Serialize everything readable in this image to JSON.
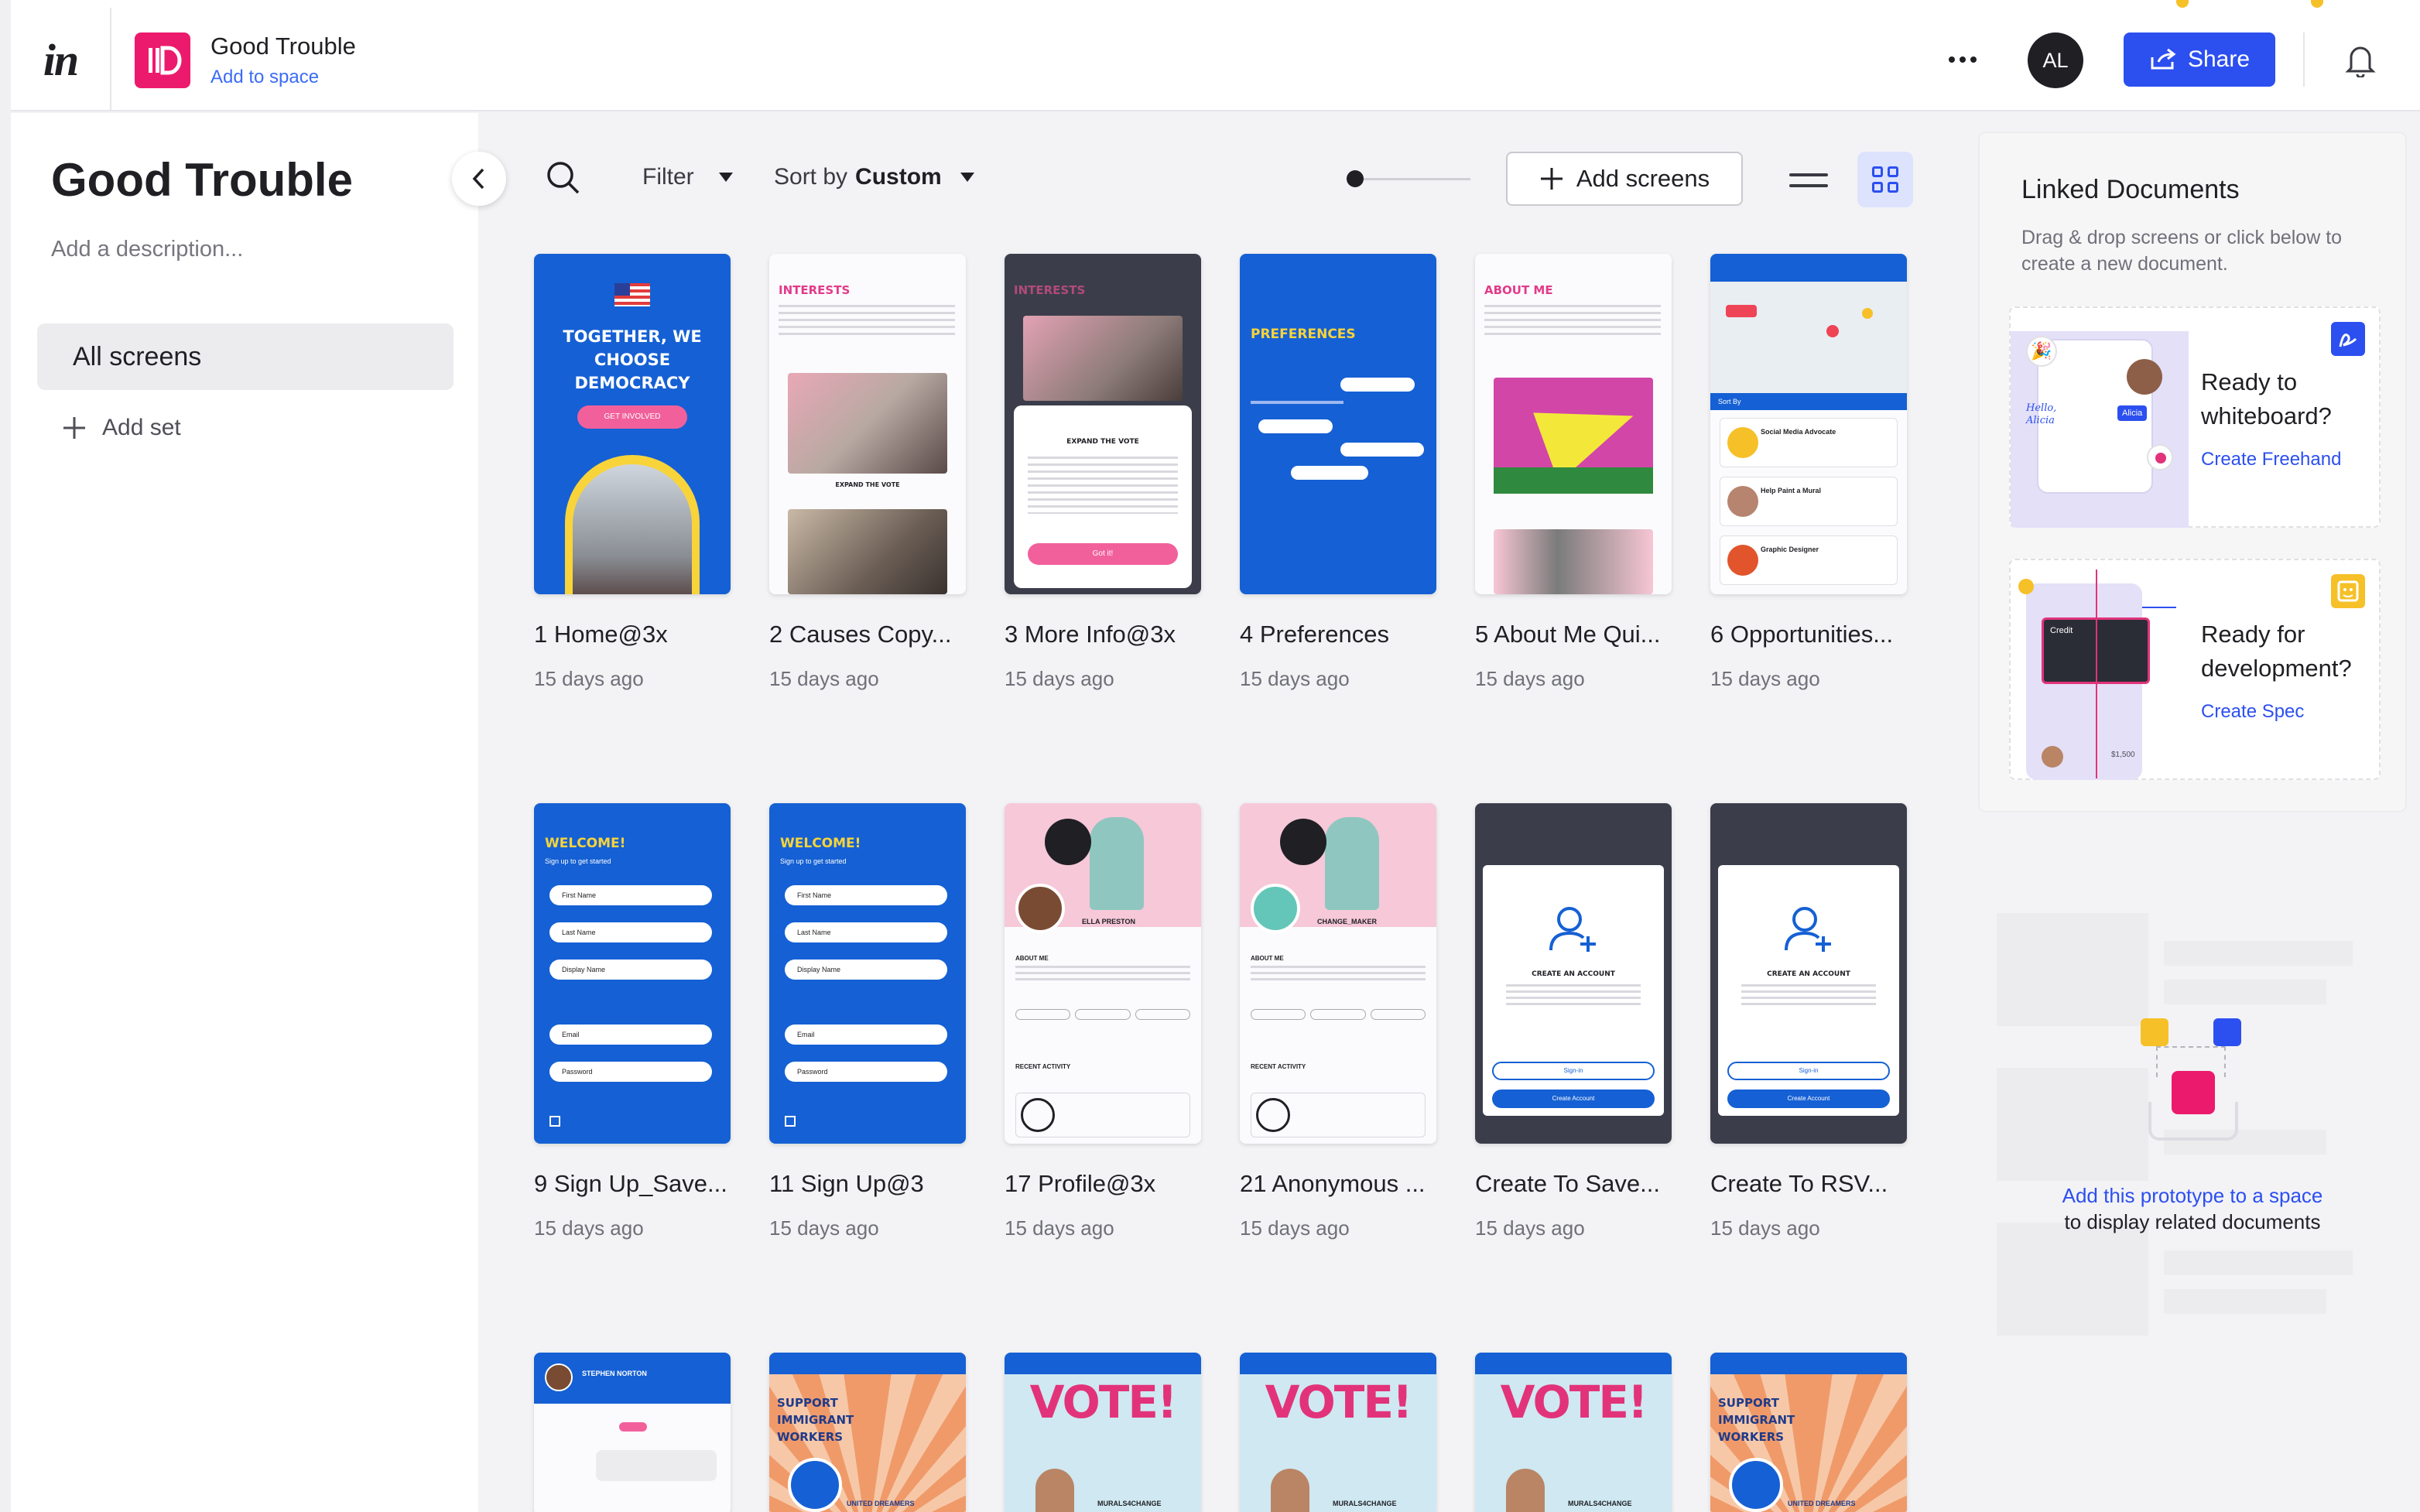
{
  "app": {
    "logo": "in",
    "project_title": "Good Trouble",
    "add_to_space": "Add to space"
  },
  "header": {
    "more_label": "More options",
    "avatar_initials": "AL",
    "share_label": "Share",
    "accent": "#2c4ff0",
    "brand": "#ec1a6c"
  },
  "sidebar": {
    "title": "Good Trouble",
    "description_placeholder": "Add a description...",
    "all_screens": "All screens",
    "add_set": "Add set"
  },
  "toolbar": {
    "filter": "Filter",
    "sort_prefix": "Sort by",
    "sort_value": "Custom",
    "add_screens": "Add screens"
  },
  "screens": [
    {
      "name": "1 Home@3x",
      "date": "15 days ago"
    },
    {
      "name": "2 Causes Copy...",
      "date": "15 days ago"
    },
    {
      "name": "3 More Info@3x",
      "date": "15 days ago"
    },
    {
      "name": "4 Preferences",
      "date": "15 days ago"
    },
    {
      "name": "5 About Me Qui...",
      "date": "15 days ago"
    },
    {
      "name": "6 Opportunities...",
      "date": "15 days ago"
    },
    {
      "name": "9 Sign Up_Save...",
      "date": "15 days ago"
    },
    {
      "name": "11 Sign Up@3",
      "date": "15 days ago"
    },
    {
      "name": "17 Profile@3x",
      "date": "15 days ago"
    },
    {
      "name": "21 Anonymous ...",
      "date": "15 days ago"
    },
    {
      "name": "Create To Save...",
      "date": "15 days ago"
    },
    {
      "name": "Create To RSV...",
      "date": "15 days ago"
    }
  ],
  "thumbs": {
    "home": "TOGETHER, WE CHOOSE DEMOCRACY",
    "home_btn": "GET INVOLVED",
    "interests": "INTERESTS",
    "expand": "EXPAND THE VOTE",
    "got_it": "Got it!",
    "preferences": "PREFERENCES",
    "about_me": "ABOUT ME",
    "welcome": "WELCOME!",
    "signup_sub": "Sign up to get started",
    "fields": [
      "First Name",
      "Last Name",
      "Display Name",
      "Email",
      "Password"
    ],
    "create_account": "CREATE AN ACCOUNT",
    "sign_in": "Sign-in",
    "create_btn": "Create Account",
    "profile_1": "ELLA PRESTON",
    "profile_2": "CHANGE_MAKER",
    "about_me_small": "ABOUT ME",
    "recent": "RECENT ACTIVITY",
    "opp_1": "Social Media Advocate",
    "opp_2": "Help Paint a Mural",
    "opp_3": "Graphic Designer",
    "sort_by": "Sort By",
    "stephen": "STEPHEN NORTON",
    "workers": "SUPPORT IMMIGRANT WORKERS",
    "vote": "VOTE!",
    "united": "UNITED DREAMERS",
    "murals": "MURALS4CHANGE"
  },
  "linked_docs": {
    "title": "Linked Documents",
    "description": "Drag & drop screens or click below to create a new document.",
    "whiteboard_heading": "Ready to whiteboard?",
    "whiteboard_link": "Create Freehand",
    "dev_heading": "Ready for development?",
    "dev_link": "Create Spec",
    "art_hello": "Hello, Alicia",
    "art_alicia": "Alicia",
    "art_credit": "Credit",
    "art_amount": "$1,500"
  },
  "space_prompt": {
    "link": "Add this prototype to a space",
    "text": "to display related documents"
  }
}
